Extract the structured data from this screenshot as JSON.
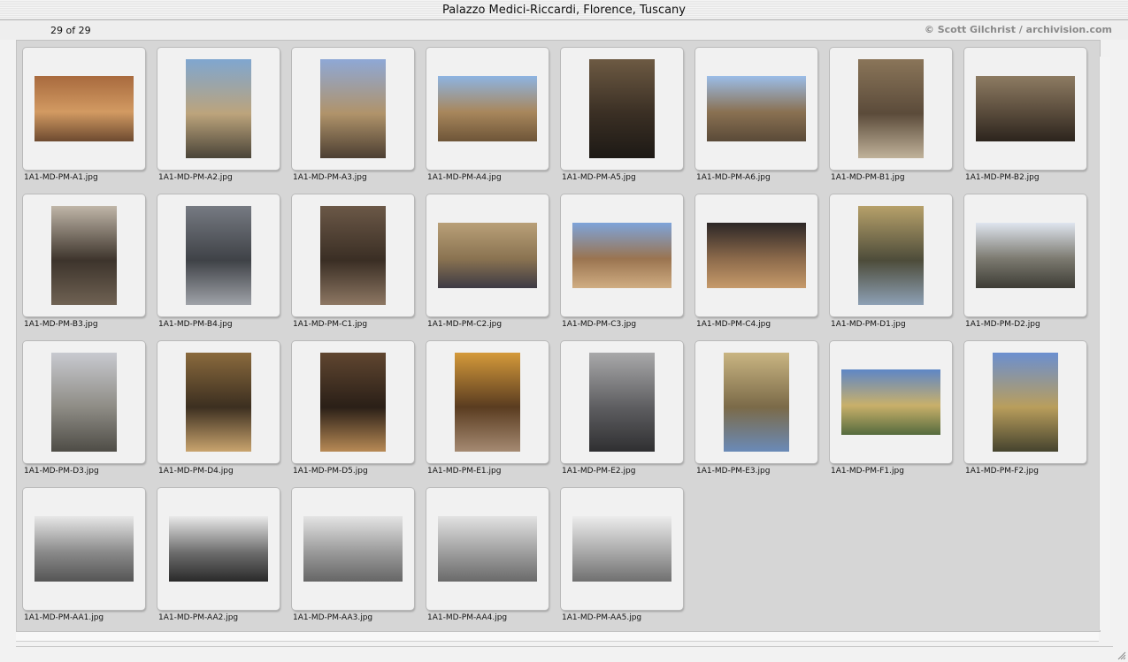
{
  "window": {
    "title": "Palazzo Medici-Riccardi, Florence, Tuscany"
  },
  "header": {
    "count": "29 of 29",
    "copyright": "© Scott Gilchrist / archivision.com"
  },
  "icons": {
    "resize": "resize-grip-icon"
  },
  "thumbnails": [
    {
      "label": "1A1-MD-PM-A1.jpg",
      "orientation": "landscape",
      "colors": [
        "#a86a3e",
        "#d29a62",
        "#6d4a30"
      ]
    },
    {
      "label": "1A1-MD-PM-A2.jpg",
      "orientation": "portrait",
      "colors": [
        "#7fa6d0",
        "#bca47c",
        "#4a4438"
      ]
    },
    {
      "label": "1A1-MD-PM-A3.jpg",
      "orientation": "portrait",
      "colors": [
        "#8ea8d6",
        "#b0936a",
        "#4c3f32"
      ]
    },
    {
      "label": "1A1-MD-PM-A4.jpg",
      "orientation": "landscape",
      "colors": [
        "#8db4e2",
        "#a8875c",
        "#6e5538"
      ]
    },
    {
      "label": "1A1-MD-PM-A5.jpg",
      "orientation": "portrait",
      "colors": [
        "#6d5a43",
        "#3a2f24",
        "#1d1915"
      ]
    },
    {
      "label": "1A1-MD-PM-A6.jpg",
      "orientation": "landscape",
      "colors": [
        "#9bbde8",
        "#8a7152",
        "#5a4a38"
      ]
    },
    {
      "label": "1A1-MD-PM-B1.jpg",
      "orientation": "portrait",
      "colors": [
        "#8a7559",
        "#5b4b3a",
        "#c0b29a"
      ]
    },
    {
      "label": "1A1-MD-PM-B2.jpg",
      "orientation": "landscape",
      "colors": [
        "#8d7b62",
        "#5a4c3c",
        "#2c241d"
      ]
    },
    {
      "label": "1A1-MD-PM-B3.jpg",
      "orientation": "portrait",
      "colors": [
        "#c0b6a8",
        "#3d342c",
        "#6f6253"
      ]
    },
    {
      "label": "1A1-MD-PM-B4.jpg",
      "orientation": "portrait",
      "colors": [
        "#767a82",
        "#3f4247",
        "#9fa2a8"
      ]
    },
    {
      "label": "1A1-MD-PM-C1.jpg",
      "orientation": "portrait",
      "colors": [
        "#6b5847",
        "#3a2e24",
        "#8d7763"
      ]
    },
    {
      "label": "1A1-MD-PM-C2.jpg",
      "orientation": "landscape",
      "colors": [
        "#b9a078",
        "#8a7351",
        "#3d3a44"
      ]
    },
    {
      "label": "1A1-MD-PM-C3.jpg",
      "orientation": "landscape",
      "colors": [
        "#7ea4da",
        "#9a7450",
        "#d0ad82"
      ]
    },
    {
      "label": "1A1-MD-PM-C4.jpg",
      "orientation": "landscape",
      "colors": [
        "#2c2626",
        "#8c6a4b",
        "#c69a6a"
      ]
    },
    {
      "label": "1A1-MD-PM-D1.jpg",
      "orientation": "portrait",
      "colors": [
        "#b7a16a",
        "#4d4c3a",
        "#8da0b5"
      ]
    },
    {
      "label": "1A1-MD-PM-D2.jpg",
      "orientation": "landscape",
      "colors": [
        "#dfe5ef",
        "#7c7a70",
        "#3d3c35"
      ]
    },
    {
      "label": "1A1-MD-PM-D3.jpg",
      "orientation": "portrait",
      "colors": [
        "#c8cad0",
        "#8e8c85",
        "#4e4c46"
      ]
    },
    {
      "label": "1A1-MD-PM-D4.jpg",
      "orientation": "portrait",
      "colors": [
        "#8a6a3d",
        "#3c2f20",
        "#c9a46e"
      ]
    },
    {
      "label": "1A1-MD-PM-D5.jpg",
      "orientation": "portrait",
      "colors": [
        "#604630",
        "#2a1f17",
        "#b88a55"
      ]
    },
    {
      "label": "1A1-MD-PM-E1.jpg",
      "orientation": "portrait",
      "colors": [
        "#d59a3a",
        "#5a3c20",
        "#a58a72"
      ]
    },
    {
      "label": "1A1-MD-PM-E2.jpg",
      "orientation": "portrait",
      "colors": [
        "#a9a9aa",
        "#5e5e61",
        "#2f2f31"
      ]
    },
    {
      "label": "1A1-MD-PM-E3.jpg",
      "orientation": "portrait",
      "colors": [
        "#c9b582",
        "#7b6a48",
        "#6a8ab8"
      ]
    },
    {
      "label": "1A1-MD-PM-F1.jpg",
      "orientation": "landscape",
      "colors": [
        "#5e86c6",
        "#c9b06a",
        "#556b3e"
      ]
    },
    {
      "label": "1A1-MD-PM-F2.jpg",
      "orientation": "portrait",
      "colors": [
        "#6b8fd0",
        "#b99e5c",
        "#45432e"
      ]
    },
    {
      "label": "1A1-MD-PM-AA1.jpg",
      "orientation": "landscape",
      "colors": [
        "#e7e7e7",
        "#8a8a8a",
        "#555555"
      ]
    },
    {
      "label": "1A1-MD-PM-AA2.jpg",
      "orientation": "landscape",
      "colors": [
        "#e9e9e9",
        "#6e6e6e",
        "#2a2a2a"
      ]
    },
    {
      "label": "1A1-MD-PM-AA3.jpg",
      "orientation": "landscape",
      "colors": [
        "#e4e4e4",
        "#9a9a9a",
        "#666666"
      ]
    },
    {
      "label": "1A1-MD-PM-AA4.jpg",
      "orientation": "landscape",
      "colors": [
        "#e2e2e2",
        "#9f9f9f",
        "#6a6a6a"
      ]
    },
    {
      "label": "1A1-MD-PM-AA5.jpg",
      "orientation": "landscape",
      "colors": [
        "#ececec",
        "#a9a9a9",
        "#707070"
      ]
    }
  ]
}
